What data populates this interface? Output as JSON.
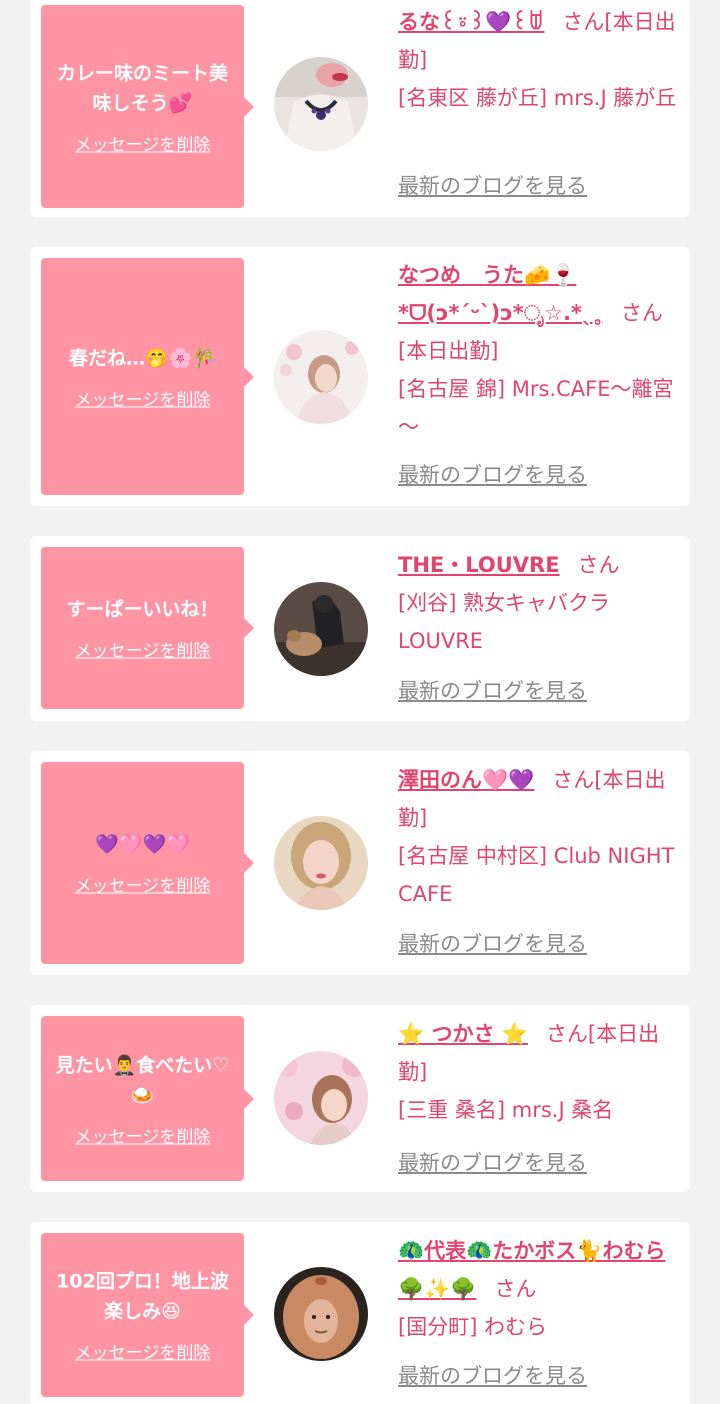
{
  "accent": "#e0446f",
  "bubble_color": "#ff95a4",
  "messages": [
    {
      "message": "カレー味のミート美味しそう💕",
      "delete_label": "メッセージを削除",
      "name": "るな꒰⍤꒱💜꒰ꌂ",
      "suffix": "さん[本日出勤]",
      "shop": "[名東区 藤が丘] mrs.J 藤が丘",
      "blog_label": "最新のブログを見る",
      "avatar": "avatar-photo-woman-necklace"
    },
    {
      "message": "春だね…🤭🌸🎋",
      "delete_label": "メッセージを削除",
      "name": "なつめ　うた🧀🍷*ᗜ(ↄ*ˊᵕˋ)ↄ*ೃ☆.*ˎ˳",
      "suffix": "さん[本日出勤]",
      "shop": "[名古屋 錦] Mrs.CAFE～離宮～",
      "blog_label": "最新のブログを見る",
      "avatar": "avatar-photo-woman-flowers"
    },
    {
      "message": "すーぱーいいね！",
      "delete_label": "メッセージを削除",
      "name": "THE・LOUVRE",
      "suffix": "さん",
      "shop": "[刈谷] 熟女キャバクラLOUVRE",
      "blog_label": "最新のブログを見る",
      "avatar": "avatar-photo-man-dog"
    },
    {
      "message": "💜🩷💜🩷",
      "delete_label": "メッセージを削除",
      "name": "澤田のん🩷💜",
      "suffix": "さん[本日出勤]",
      "shop": "[名古屋 中村区] Club NIGHT CAFE",
      "blog_label": "最新のブログを見る",
      "avatar": "avatar-photo-woman-portrait"
    },
    {
      "message": "見たい🤵‍♂️食べたい♡🍛",
      "delete_label": "メッセージを削除",
      "name": "⭐ つかさ ⭐",
      "suffix": "さん[本日出勤]",
      "shop": "[三重 桑名] mrs.J 桑名",
      "blog_label": "最新のブログを見る",
      "avatar": "avatar-photo-woman-cherry-blossom"
    },
    {
      "message": "102回プロ！地上波楽しみ😆",
      "delete_label": "メッセージを削除",
      "name": "🦚代表🦚たかボス🐈わむら🌳✨🌳",
      "suffix": "さん",
      "shop": "[国分町] わむら",
      "blog_label": "最新のブログを見る",
      "avatar": "avatar-photo-egg-face"
    }
  ]
}
